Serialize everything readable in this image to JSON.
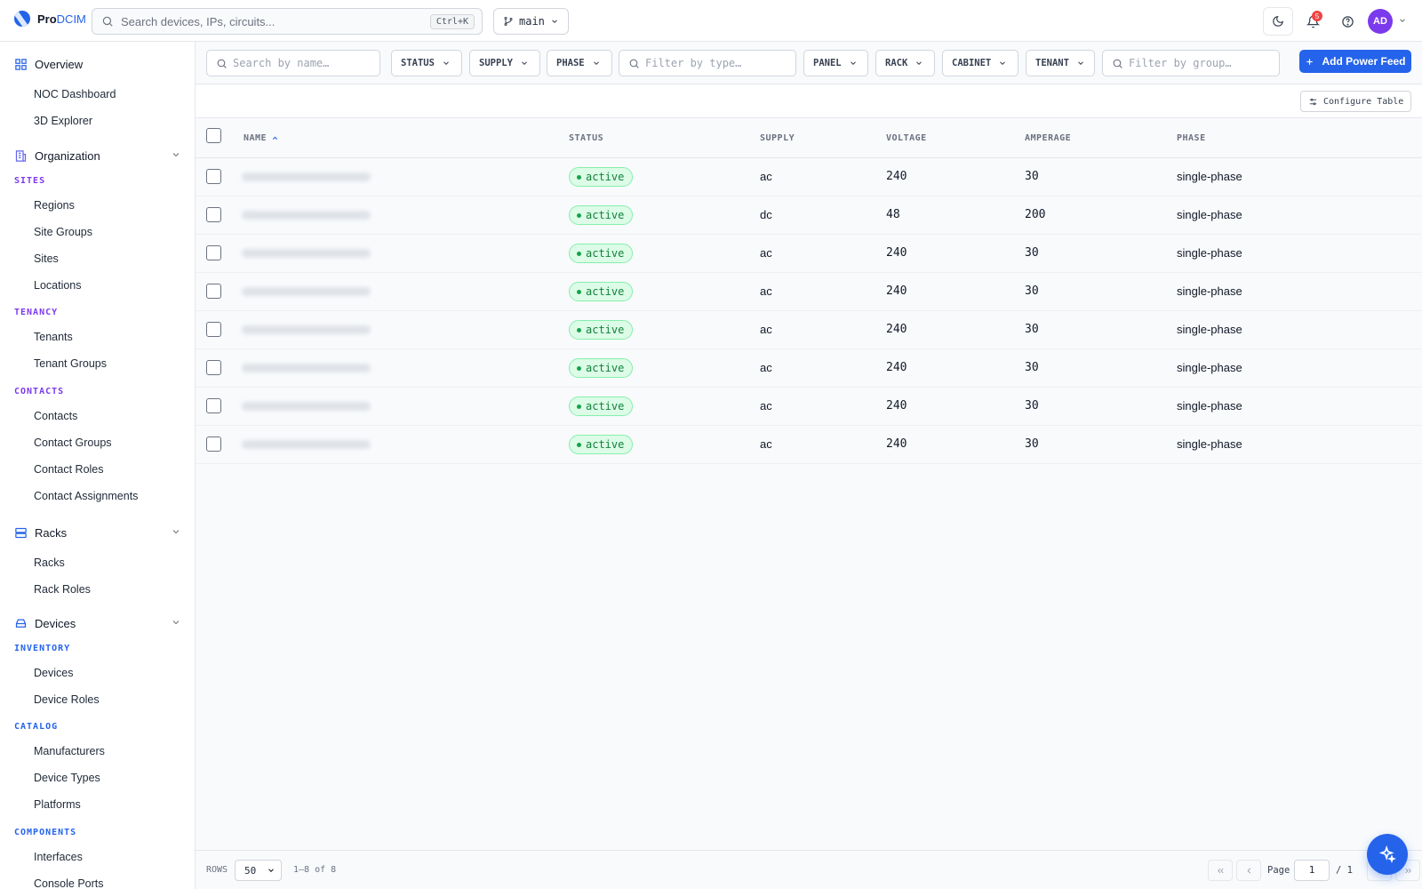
{
  "app": {
    "brand_pro": "Pro",
    "brand_dcim": "DCIM"
  },
  "search": {
    "placeholder": "Search devices, IPs, circuits...",
    "shortcut": "Ctrl+K"
  },
  "branch": {
    "label": "main"
  },
  "notifications": {
    "count": "5"
  },
  "user": {
    "initials": "AD"
  },
  "sidebar": {
    "overview": "Overview",
    "overview_items": [
      "NOC Dashboard",
      "3D Explorer"
    ],
    "organization": "Organization",
    "sites_title": "SITES",
    "sites_items": [
      "Regions",
      "Site Groups",
      "Sites",
      "Locations"
    ],
    "tenancy_title": "TENANCY",
    "tenancy_items": [
      "Tenants",
      "Tenant Groups"
    ],
    "contacts_title": "CONTACTS",
    "contacts_items": [
      "Contacts",
      "Contact Groups",
      "Contact Roles",
      "Contact Assignments"
    ],
    "racks": "Racks",
    "racks_items": [
      "Racks",
      "Rack Roles"
    ],
    "devices": "Devices",
    "inventory_title": "INVENTORY",
    "inventory_items": [
      "Devices",
      "Device Roles"
    ],
    "catalog_title": "CATALOG",
    "catalog_items": [
      "Manufacturers",
      "Device Types",
      "Platforms"
    ],
    "components_title": "COMPONENTS",
    "components_items": [
      "Interfaces",
      "Console Ports"
    ]
  },
  "filters": {
    "name_placeholder": "Search by name…",
    "status": "STATUS",
    "supply": "SUPPLY",
    "phase": "PHASE",
    "type_placeholder": "Filter by type…",
    "panel": "PANEL",
    "rack": "RACK",
    "cabinet": "CABINET",
    "tenant": "TENANT",
    "group_placeholder": "Filter by group…",
    "add_button": "Add Power Feed"
  },
  "table": {
    "configure": "Configure Table",
    "columns": {
      "name": "NAME",
      "status": "STATUS",
      "supply": "SUPPLY",
      "voltage": "VOLTAGE",
      "amperage": "AMPERAGE",
      "phase": "PHASE"
    },
    "rows": [
      {
        "status": "active",
        "supply": "ac",
        "voltage": "240",
        "amperage": "30",
        "phase": "single-phase"
      },
      {
        "status": "active",
        "supply": "dc",
        "voltage": "48",
        "amperage": "200",
        "phase": "single-phase"
      },
      {
        "status": "active",
        "supply": "ac",
        "voltage": "240",
        "amperage": "30",
        "phase": "single-phase"
      },
      {
        "status": "active",
        "supply": "ac",
        "voltage": "240",
        "amperage": "30",
        "phase": "single-phase"
      },
      {
        "status": "active",
        "supply": "ac",
        "voltage": "240",
        "amperage": "30",
        "phase": "single-phase"
      },
      {
        "status": "active",
        "supply": "ac",
        "voltage": "240",
        "amperage": "30",
        "phase": "single-phase"
      },
      {
        "status": "active",
        "supply": "ac",
        "voltage": "240",
        "amperage": "30",
        "phase": "single-phase"
      },
      {
        "status": "active",
        "supply": "ac",
        "voltage": "240",
        "amperage": "30",
        "phase": "single-phase"
      }
    ]
  },
  "footer": {
    "rows_label": "ROWS",
    "rows_value": "50",
    "range": "1–8 of 8",
    "page_label": "Page",
    "page_value": "1",
    "page_total": "/ 1"
  },
  "colors": {
    "accent": "#2563eb",
    "active_bg": "#dcfce7",
    "active_text": "#15803d",
    "avatar": "#7c3aed",
    "badge": "#ef4444"
  }
}
